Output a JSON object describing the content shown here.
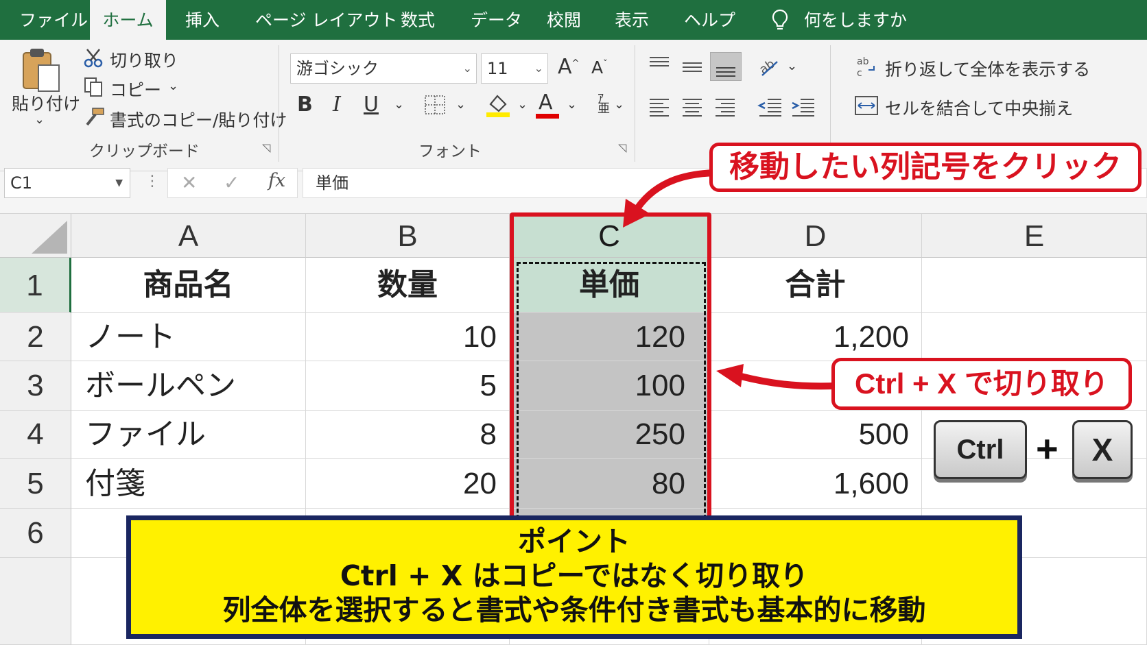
{
  "tabs": [
    "ファイル",
    "ホーム",
    "挿入",
    "ページ レイアウト",
    "数式",
    "データ",
    "校閲",
    "表示",
    "ヘルプ"
  ],
  "tell_me": "何をしますか",
  "clipboard": {
    "paste": "貼り付け",
    "cut": "切り取り",
    "copy": "コピー",
    "format_painter": "書式のコピー/貼り付け",
    "group_label": "クリップボード"
  },
  "font": {
    "name": "游ゴシック",
    "size": "11",
    "group_label": "フォント",
    "fill_color": "#ffeb00",
    "font_color": "#e00000"
  },
  "alignment": {
    "wrap_text": "折り返して全体を表示する",
    "merge_center": "セルを結合して中央揃え"
  },
  "formula_bar": {
    "name_box": "C1",
    "fx": "fx",
    "content": "単価"
  },
  "columns": [
    "A",
    "B",
    "C",
    "D",
    "E"
  ],
  "rows": [
    "1",
    "2",
    "3",
    "4",
    "5",
    "6"
  ],
  "cells": [
    [
      "商品名",
      "数量",
      "単価",
      "合計"
    ],
    [
      "ノート",
      "10",
      "120",
      "1,200"
    ],
    [
      "ボールペン",
      "5",
      "100",
      ""
    ],
    [
      "ファイル",
      "8",
      "250",
      "500"
    ],
    [
      "付箋",
      "20",
      "80",
      "1,600"
    ]
  ],
  "callout_click": "移動したい列記号をクリック",
  "callout_cut": "Ctrl + X で切り取り",
  "keys": {
    "ctrl": "Ctrl",
    "plus": "+",
    "x": "X"
  },
  "point": {
    "title": "ポイント",
    "line1": "Ctrl + X はコピーではなく切り取り",
    "line2": "列全体を選択すると書式や条件付き書式も基本的に移動"
  },
  "colors": {
    "excel_green": "#1f6f3f",
    "callout_red": "#d9121f",
    "point_yellow": "#fff100",
    "point_border": "#1a2660",
    "selected_col": "#c7dfd1"
  }
}
